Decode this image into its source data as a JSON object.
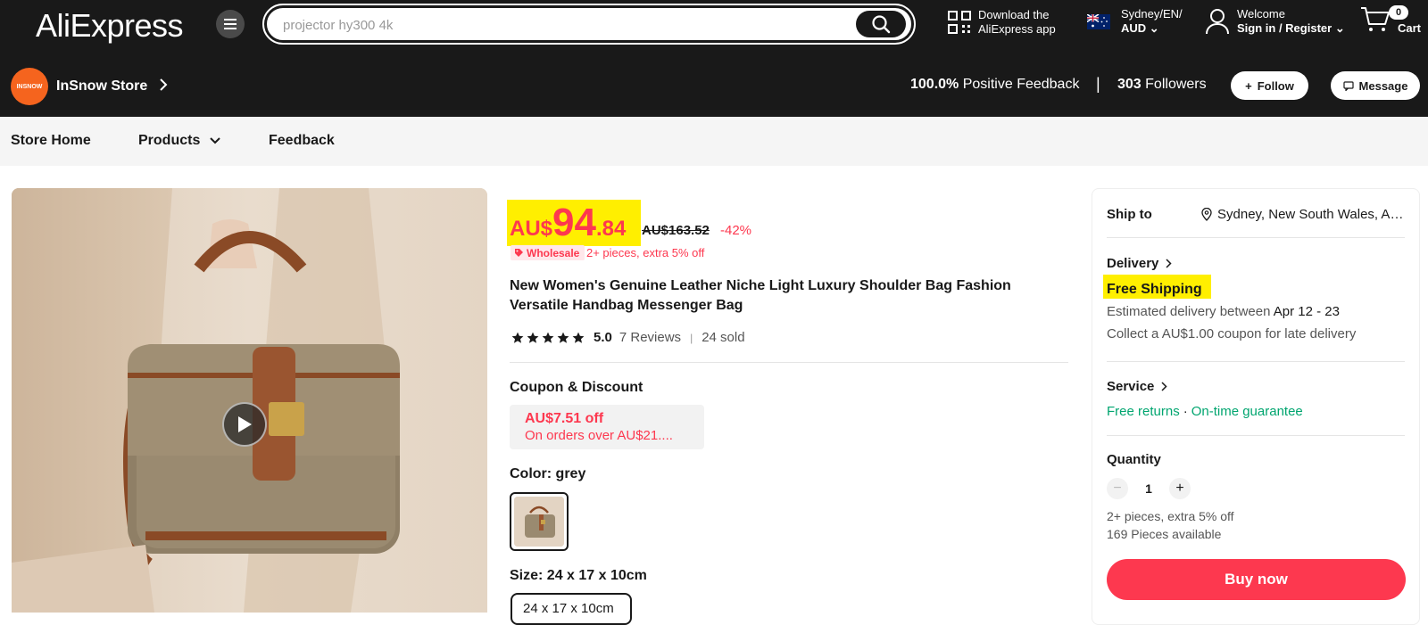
{
  "header": {
    "logo": "AliExpress",
    "search_value": "projector hy300 4k",
    "app_download_line1": "Download the",
    "app_download_line2": "AliExpress app",
    "region_line1": "Sydney/EN/",
    "region_line2": "AUD",
    "account_line1": "Welcome",
    "account_line2": "Sign in / Register",
    "cart_count": "0",
    "cart_label": "Cart"
  },
  "store": {
    "logo_text": "INSNOW",
    "name": "InSnow Store",
    "feedback_value": "100.0%",
    "feedback_label": "Positive Feedback",
    "separator": "|",
    "followers_value": "303",
    "followers_label": "Followers",
    "follow_label": "Follow",
    "message_label": "Message"
  },
  "nav": {
    "home": "Store Home",
    "products": "Products",
    "feedback": "Feedback"
  },
  "product": {
    "price_currency": "AU$",
    "price_int": "94",
    "price_dec": ".84",
    "original_price": "AU$163.52",
    "discount": "-42%",
    "wholesale_badge": "Wholesale",
    "wholesale_text": "2+ pieces, extra 5% off",
    "title": "New Women's Genuine Leather Niche Light Luxury Shoulder Bag Fashion Versatile Handbag Messenger Bag",
    "rating": "5.0",
    "reviews": "7 Reviews",
    "divider": "|",
    "sold": "24 sold",
    "coupon_title": "Coupon & Discount",
    "coupon_amount": "AU$7.51 off",
    "coupon_condition": "On orders over AU$21....",
    "color_label": "Color: grey",
    "size_label": "Size: 24 x 17 x 10cm",
    "size_option": "24 x 17 x 10cm"
  },
  "sidebar": {
    "ship_to_label": "Ship to",
    "ship_to_value": "Sydney, New South Wales, Australia",
    "delivery_label": "Delivery",
    "free_shipping": "Free Shipping",
    "estimate_prefix": "Estimated delivery between",
    "estimate_dates": "Apr 12 - 23",
    "late_coupon": "Collect a AU$1.00 coupon for late delivery",
    "service_label": "Service",
    "service_returns": "Free returns",
    "service_dot": "·",
    "service_guarantee": "On-time guarantee",
    "quantity_label": "Quantity",
    "quantity_value": "1",
    "quantity_minus": "−",
    "quantity_plus": "+",
    "quantity_discount": "2+ pieces, extra 5% off",
    "quantity_available": "169 Pieces available",
    "buy_now": "Buy now"
  },
  "colors": {
    "brand_red": "#fd384f",
    "highlight": "#ffef00",
    "dark": "#191919",
    "green": "#00a56f",
    "store_orange": "#f5641e"
  }
}
